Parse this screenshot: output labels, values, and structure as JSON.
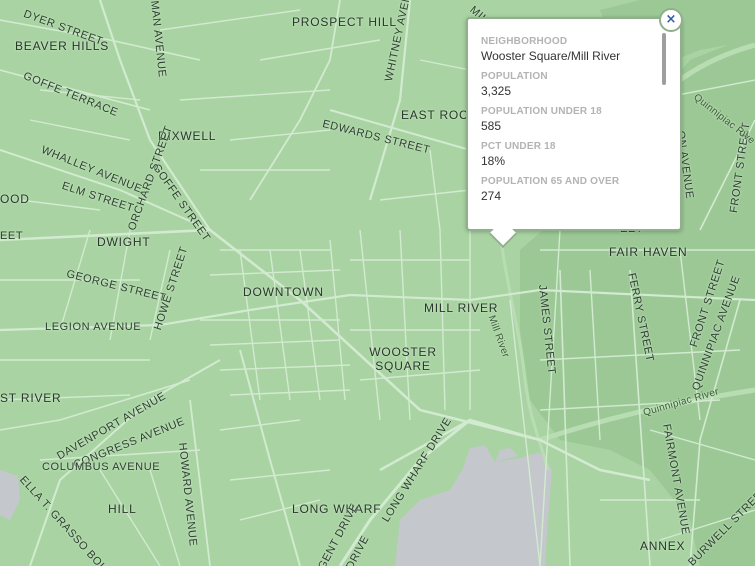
{
  "colors": {
    "land": "#a9d3a3",
    "street": "#d2ead0",
    "water": "#c4c7cc",
    "popup_border": "#8fb08a"
  },
  "map": {
    "neighborhoods": [
      "PROSPECT HILL",
      "BEAVER HILLS",
      "DIXWELL",
      "DWIGHT",
      "DOWNTOWN",
      "EAST ROCK",
      "FAIR HAVEN",
      "MILL RIVER",
      "WOOSTER SQUARE",
      "HILL",
      "LONG WHARF",
      "ANNEX",
      "OOD",
      "ST RIVER"
    ],
    "streets": [
      "DYER STREET",
      "GOFFE TERRACE",
      "WHALLEY AVENUE",
      "ELM STREET",
      "GOFFE STREET",
      "ORCHARD STREET",
      "GEORGE STREET",
      "HOWE STREET",
      "LEGION AVENUE",
      "DAVENPORT AVENUE",
      "CONGRESS AVENUE",
      "COLUMBUS AVENUE",
      "ELLA T. GRASSO BOULE",
      "HOWARD AVENUE",
      "LONG WHARF DRIVE",
      "EDWARDS STREET",
      "WHITNEY AVENUE",
      "JAMES STREET",
      "FERRY STREET",
      "FRONT STREET",
      "FRONT STREET",
      "QUINNIPIAC AVENUE",
      "FAIRMONT AVENUE",
      "BURWELL STREET",
      "EET",
      "EET",
      "GENT DRIVE",
      "DRIVE",
      "MAN AVENUE",
      "MILL",
      "ON AVENUE"
    ],
    "water": [
      "Quinnipiac River",
      "Mill River",
      "Quinnipiac Rive"
    ]
  },
  "popup": {
    "fields": [
      {
        "label": "NEIGHBORHOOD",
        "value": "Wooster Square/Mill River"
      },
      {
        "label": "POPULATION",
        "value": "3,325"
      },
      {
        "label": "POPULATION UNDER 18",
        "value": "585"
      },
      {
        "label": "PCT UNDER 18",
        "value": "18%"
      },
      {
        "label": "POPULATION 65 AND OVER",
        "value": "274"
      }
    ],
    "close_symbol": "×"
  }
}
